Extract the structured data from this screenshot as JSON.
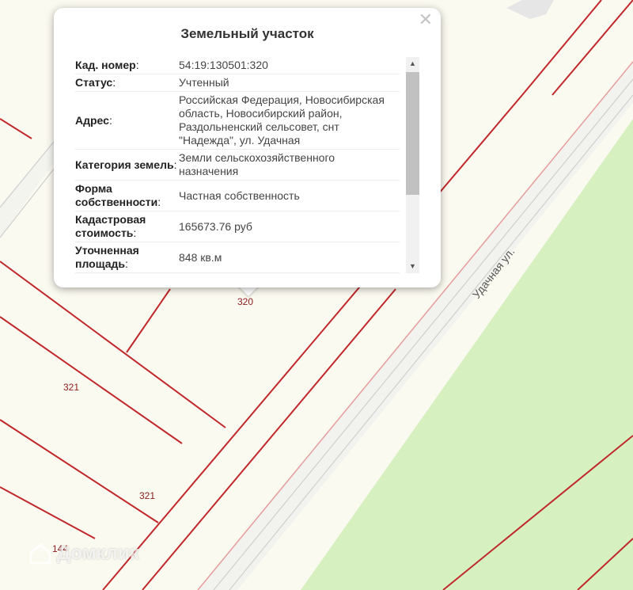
{
  "map": {
    "plot_labels": [
      "320",
      "321",
      "321",
      "144"
    ],
    "street_label": "Удачная ул."
  },
  "popup": {
    "title": "Земельный участок",
    "rows": [
      {
        "key": "Кад. номер",
        "value": "54:19:130501:320"
      },
      {
        "key": "Статус",
        "value": "Учтенный"
      },
      {
        "key": "Адрес",
        "value": "Российская Федерация, Новосибирская область, Новосибирский район, Раздольненский сельсовет, снт \"Надежда\", ул. Удачная"
      },
      {
        "key": "Категория земель",
        "value": "Земли сельскохозяйственного назначения"
      },
      {
        "key": "Форма собственности",
        "value": "Частная собственность"
      },
      {
        "key": "Кадастровая стоимость",
        "value": "165673.76 руб"
      },
      {
        "key": "Уточненная площадь",
        "value": "848 кв.м"
      }
    ],
    "close_icon": "close-icon"
  },
  "watermark": {
    "text": "Домклик"
  },
  "colors": {
    "map_background": "#fbfaf0",
    "parcel_border": "#c0282c",
    "green_area": "#d6f0c0"
  }
}
